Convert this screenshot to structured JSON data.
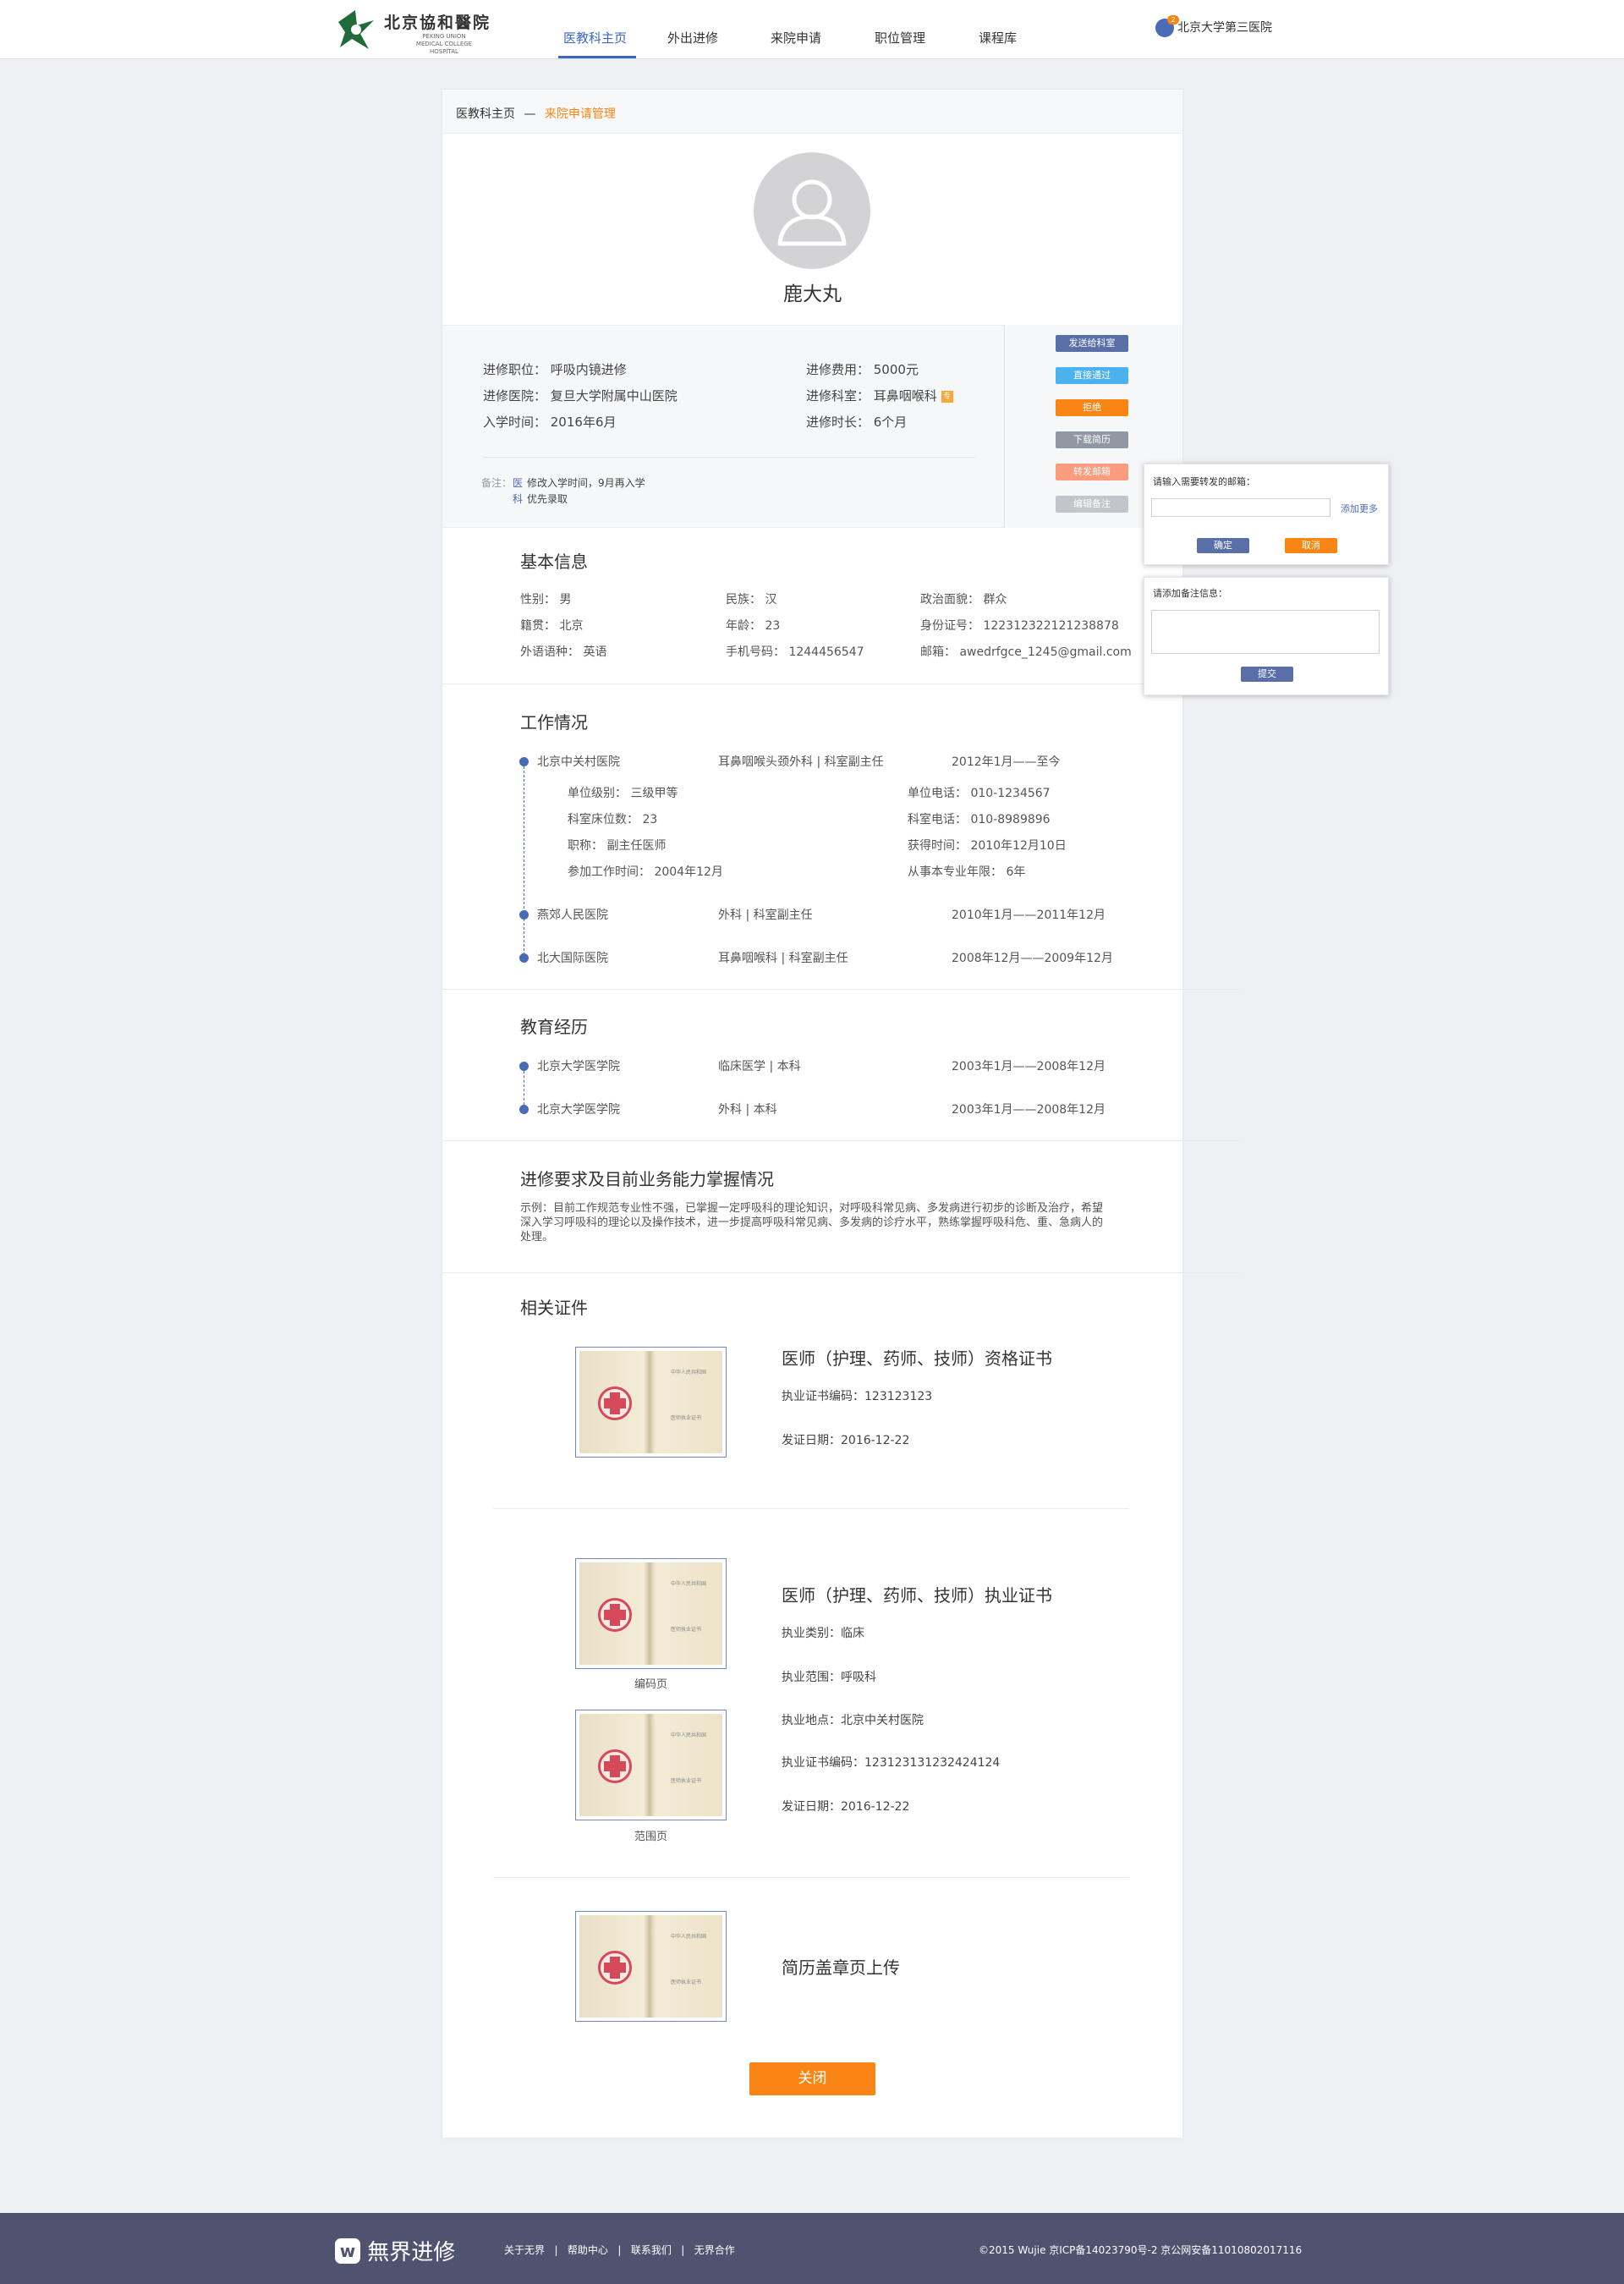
{
  "header": {
    "logo_cn": "北京協和醫院",
    "logo_en": "PEKING UNION MEDICAL COLLEGE HOSPITAL",
    "nav": [
      "医教科主页",
      "外出进修",
      "来院申请",
      "职位管理",
      "课程库"
    ],
    "user": "北京大学第三医院",
    "user_badge": "2"
  },
  "breadcrumb": {
    "home": "医教科主页",
    "sep": "—",
    "current": "来院申请管理"
  },
  "profile": {
    "name": "鹿大丸"
  },
  "info": {
    "position": "进修职位：  呼吸内镜进修",
    "hospital": "进修医院：  复旦大学附属中山医院",
    "entry": "入学时间：  2016年6月",
    "fee": "进修费用：  5000元",
    "dept": "进修科室：  耳鼻咽喉科",
    "dept_tag": "专",
    "duration": "进修时长：  6个月"
  },
  "notes": {
    "label": "备注：",
    "items": [
      {
        "who": "医",
        "text": "修改入学时间，9月再入学"
      },
      {
        "who": "科",
        "text": "优先录取"
      }
    ]
  },
  "actions": [
    "发送给科室",
    "直接通过",
    "拒绝",
    "下载简历",
    "转发邮箱",
    "编辑备注"
  ],
  "forward_popup": {
    "title": "请输入需要转发的邮箱：",
    "add_more": "添加更多",
    "confirm": "确定",
    "cancel": "取消"
  },
  "note_popup": {
    "title": "请添加备注信息：",
    "submit": "提交"
  },
  "basic": {
    "title": "基本信息",
    "row1": [
      "性别：  男",
      "民族：  汉",
      "政治面貌：  群众"
    ],
    "row2": [
      "籍贯：  北京",
      "年龄：  23",
      "身份证号：  122312322121238878"
    ],
    "row3": [
      "外语语种：  英语",
      "手机号码：  1244456547",
      "邮箱：  awedrfgce_1245@gmail.com"
    ]
  },
  "work": {
    "title": "工作情况",
    "jobs": [
      {
        "org": "北京中关村医院",
        "dept": "耳鼻咽喉头颈外科 | 科室副主任",
        "time": "2012年1月——至今"
      },
      {
        "org": "燕郊人民医院",
        "dept": "外科 | 科室副主任",
        "time": "2010年1月——2011年12月"
      },
      {
        "org": "北大国际医院",
        "dept": "耳鼻咽喉科 | 科室副主任",
        "time": "2008年12月——2009年12月"
      }
    ],
    "details_left": [
      "单位级别：  三级甲等",
      "科室床位数：  23",
      "职称：  副主任医师",
      "参加工作时间：  2004年12月"
    ],
    "details_right": [
      "单位电话：  010-1234567",
      "科室电话：  010-8989896",
      "获得时间：  2010年12月10日",
      "从事本专业年限：  6年"
    ]
  },
  "education": {
    "title": "教育经历",
    "items": [
      {
        "org": "北京大学医学院",
        "major": "临床医学 | 本科",
        "time": "2003年1月——2008年12月"
      },
      {
        "org": "北京大学医学院",
        "major": "外科 | 本科",
        "time": "2003年1月——2008年12月"
      }
    ]
  },
  "requirement": {
    "title": "进修要求及目前业务能力掌握情况",
    "text": "示例：目前工作规范专业性不强，已掌握一定呼吸科的理论知识，对呼吸科常见病、多发病进行初步的诊断及治疗，希望深入学习呼吸科的理论以及操作技术，进一步提高呼吸科常见病、多发病的诊疗水平，熟练掌握呼吸科危、重、急病人的处理。"
  },
  "certs": {
    "title": "相关证件",
    "image_text": [
      "中华人民共和国",
      "医师执业证书"
    ],
    "c1": {
      "title": "医师（护理、药师、技师）资格证书",
      "f1": "执业证书编码：123123123",
      "f2": "发证日期：2016-12-22"
    },
    "c2": {
      "title": "医师（护理、药师、技师）执业证书",
      "f1": "执业类别：临床",
      "f2": "执业范围：呼吸科",
      "f3": "执业地点：北京中关村医院",
      "f4": "执业证书编码：123123131232424124",
      "f5": "发证日期：2016-12-22",
      "cap1": "编码页",
      "cap2": "范围页"
    },
    "c3": {
      "title": "简历盖章页上传"
    }
  },
  "close_label": "关闭",
  "footer": {
    "brand": "無界进修",
    "links": "关于无界   |   帮助中心   |   联系我们   |   无界合作",
    "copy": "©2015 Wujie 京ICP备14023790号-2  京公网安备11010802017116"
  },
  "colors": {
    "accent": "#3a66c8",
    "orange": "#f98614",
    "timeline": "#4a6bb5",
    "footer": "#4f5370"
  }
}
